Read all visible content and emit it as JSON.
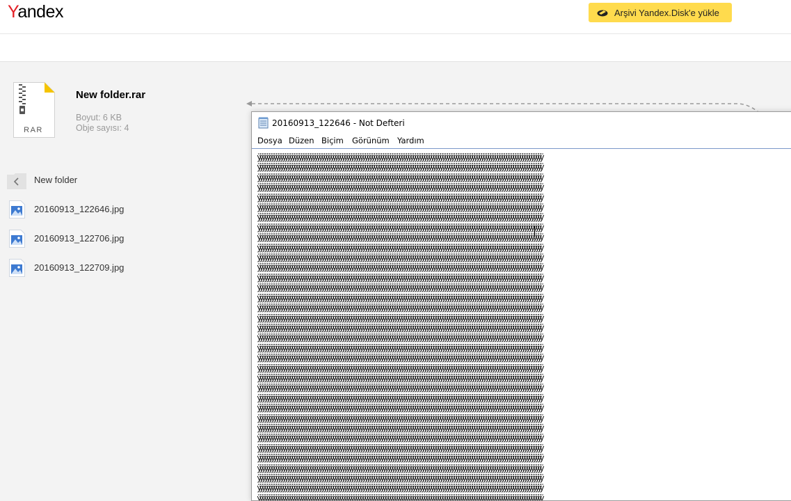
{
  "header": {
    "logo_first": "Y",
    "logo_rest": "andex",
    "upload_button_label": "Arşivi Yandex.Disk'e yükle"
  },
  "archive": {
    "icon_label": "RAR",
    "name": "New folder.rar",
    "size": "Boyut: 6 KB",
    "objects": "Obje sayısı: 4"
  },
  "filelist": {
    "folder": "New folder",
    "files": [
      "20160913_122646.jpg",
      "20160913_122706.jpg",
      "20160913_122709.jpg"
    ]
  },
  "notepad": {
    "title": "20160913_122646 - Not Defteri",
    "menu": [
      "Dosya",
      "Düzen",
      "Biçim",
      "Görünüm",
      "Yardım"
    ],
    "line_text": "ÿÿÿÿÿÿÿÿÿÿÿÿÿÿÿÿÿÿÿÿÿÿÿÿÿÿÿÿÿÿÿÿÿÿÿÿÿÿÿÿÿÿÿÿÿÿÿÿÿÿÿÿÿÿÿÿÿÿÿÿÿÿÿÿÿÿÿÿÿÿÿÿÿÿÿÿÿÿÿÿÿÿÿÿÿÿÿÿÿÿÿÿÿÿÿÿÿÿÿÿÿÿÿÿÿÿÿÿÿÿÿÿÿÿÿÿÿÿÿÿÿÿÿÿÿ"
  },
  "colors": {
    "accent_yellow": "#ffdb4d",
    "logo_red": "#e31e24"
  }
}
